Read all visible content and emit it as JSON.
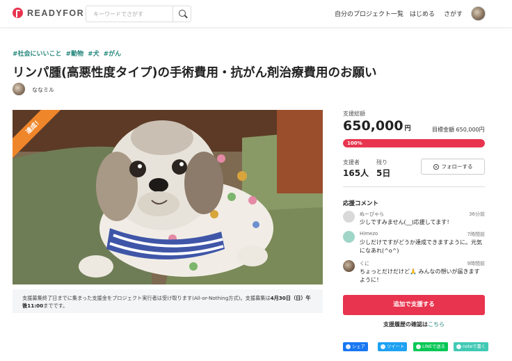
{
  "header": {
    "logo_text": "READYFOR",
    "search_placeholder": "キーワードでさがす",
    "nav": [
      "自分のプロジェクト一覧",
      "はじめる",
      "さがす"
    ]
  },
  "project": {
    "tags": [
      "#社会にいいこと",
      "#動物",
      "#犬",
      "#がん"
    ],
    "title": "リンパ腫(高悪性度タイプ)の手術費用・抗がん剤治療費用のお願い",
    "owner_name": "ななミル",
    "badge": "達成！",
    "notice_prefix": "支援募集終了日までに集まった支援金をプロジェクト実行者は受け取ります(All-or-Nothing方式)。支援募集は",
    "notice_bold": "4月30日（日）午後11:00",
    "notice_suffix": "までです。"
  },
  "stats": {
    "total_label": "支援総額",
    "total_amount": "650,000",
    "total_unit": "円",
    "goal_label": "目標金額",
    "goal_amount": "650,000円",
    "progress_label": "100%",
    "progress_fraction": 1.0,
    "supporters_label": "支援者",
    "supporters_value": "165人",
    "remaining_label": "残り",
    "remaining_value": "5日",
    "follow_label": "フォローする"
  },
  "comments": {
    "title": "応援コメント",
    "items": [
      {
        "name": "ぬーぴゃら",
        "time": "36分前",
        "text": "少しですみません(__)応援してます！"
      },
      {
        "name": "Himezo",
        "time": "7時間前",
        "text": "少しだけですがどうか達成できますように。元気になあれ(^o^)"
      },
      {
        "name": "くに",
        "time": "9時間前",
        "text": "ちょっとだけだけど🙏 みんなの想いが届きますように！"
      }
    ]
  },
  "actions": {
    "support_button": "追加で支援する",
    "history_text": "支援履歴の確認は",
    "history_link": "こちら"
  },
  "share": {
    "facebook": "シェア",
    "twitter": "ツイート",
    "line": "LINEで送る",
    "note": "noteで書く"
  },
  "colors": {
    "brand": "#e8344e",
    "tag": "#23867a",
    "badge": "#f0862a",
    "facebook": "#1877f2",
    "twitter": "#1da1f2",
    "line": "#06c755",
    "note": "#41c9b4"
  }
}
